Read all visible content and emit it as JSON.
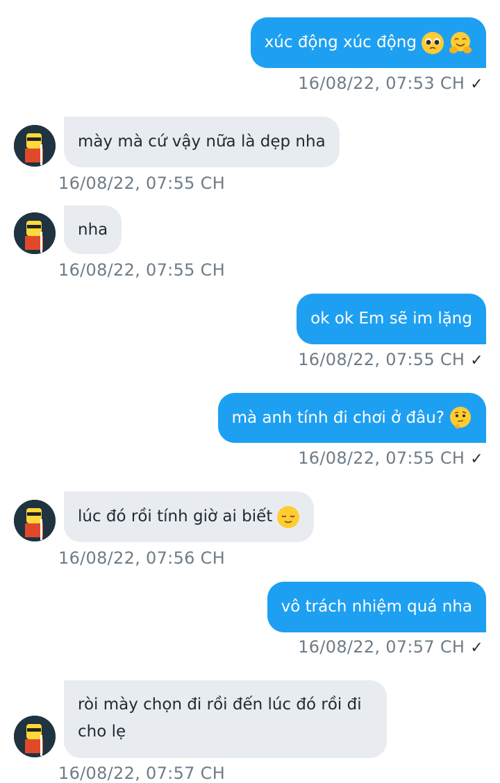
{
  "messages": [
    {
      "side": "out",
      "text": "xúc động xúc động",
      "emoji": [
        "pleading-face-emoji",
        "hugging-face-emoji"
      ],
      "time": "16/08/22,  07:53 CH",
      "check": "✓"
    },
    {
      "side": "in",
      "text": "mày mà cứ vậy nữa là dẹp nha",
      "emoji": [],
      "time": "16/08/22,  07:55 CH"
    },
    {
      "side": "in",
      "text": "nha",
      "emoji": [],
      "time": "16/08/22,  07:55 CH"
    },
    {
      "side": "out",
      "text": "ok ok Em sẽ im lặng",
      "emoji": [],
      "time": "16/08/22,  07:55 CH",
      "check": "✓"
    },
    {
      "side": "out",
      "text": "mà anh tính đi chơi ở đâu?",
      "emoji": [
        "thinking-face-emoji"
      ],
      "time": "16/08/22,  07:55 CH",
      "check": "✓"
    },
    {
      "side": "in",
      "text": "lúc đó rồi tính giờ ai biết",
      "emoji": [
        "relieved-face-emoji"
      ],
      "time": "16/08/22,  07:56 CH"
    },
    {
      "side": "out",
      "text": "vô trách nhiệm quá nha",
      "emoji": [],
      "time": "16/08/22,  07:57 CH",
      "check": "✓"
    },
    {
      "side": "in",
      "text_lines": [
        "ròi mày chọn đi rồi đến lúc đó rồi đi",
        "cho lẹ"
      ],
      "emoji": [],
      "time": "16/08/22,  07:57 CH"
    }
  ],
  "colors": {
    "outgoing_bubble": "#1ea0f2",
    "incoming_bubble": "#e8ecf0",
    "timestamp": "#6e7c87"
  },
  "icons": {
    "avatar": "cartoon-character-avatar",
    "read_check": "check-icon"
  }
}
